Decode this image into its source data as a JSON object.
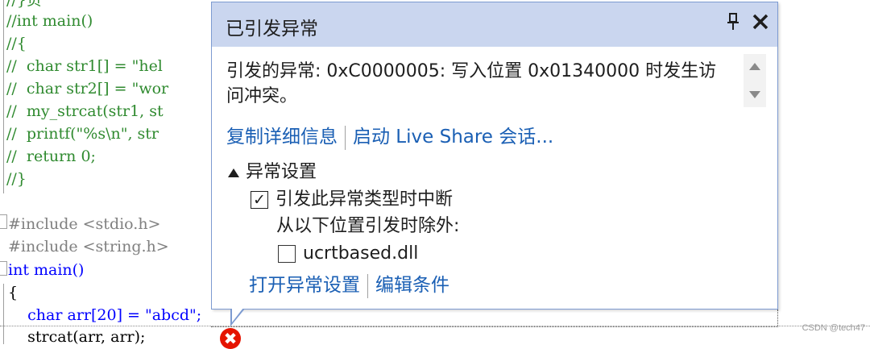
{
  "editor": {
    "lines": [
      {
        "text": "//}负",
        "cls": "c-comment"
      },
      {
        "text": "//int main()",
        "cls": "c-comment"
      },
      {
        "text": "//{",
        "cls": "c-comment"
      },
      {
        "text": "//  char str1[] = \"hel",
        "cls": "c-comment"
      },
      {
        "text": "//  char str2[] = \"wor",
        "cls": "c-comment"
      },
      {
        "text": "//  my_strcat(str1, st",
        "cls": "c-comment"
      },
      {
        "text": "//  printf(\"%s\\n\", str",
        "cls": "c-comment"
      },
      {
        "text": "//  return 0;",
        "cls": "c-comment"
      },
      {
        "text": "//}",
        "cls": "c-comment"
      },
      {
        "text": "",
        "cls": "c-plain"
      },
      {
        "text": "#include <stdio.h>",
        "cls": "c-pp"
      },
      {
        "text": "#include <string.h>",
        "cls": "c-pp"
      },
      {
        "text": "int main()",
        "cls": "c-plain"
      },
      {
        "text": "{",
        "cls": "c-plain"
      },
      {
        "text": "    char arr[20] = \"abcd\";",
        "cls": "c-plain"
      },
      {
        "text": "    strcat(arr, arr);",
        "cls": "c-plain"
      }
    ]
  },
  "popup": {
    "title": "已引发异常",
    "pin_glyph": "📌",
    "close_glyph": "✕",
    "message": "引发的异常: 0xC0000005: 写入位置 0x01340000 时发生访问冲突。",
    "link_copy": "复制详细信息",
    "link_liveshare": "启动 Live Share 会话...",
    "settings_header": "异常设置",
    "break_checkbox_label": "引发此异常类型时中断",
    "break_checked": true,
    "except_label": "从以下位置引发时除外:",
    "module_checkbox_label": "ucrtbased.dll",
    "module_checked": false,
    "link_open_settings": "打开异常设置",
    "link_edit_conditions": "编辑条件"
  },
  "status": {
    "error_glyph": "✖"
  },
  "watermark": "CSDN @tech47",
  "colors": {
    "title_bg": "#cad6ef",
    "link": "#1a5fb4",
    "comment": "#2f8a2f",
    "error": "#e51400"
  }
}
